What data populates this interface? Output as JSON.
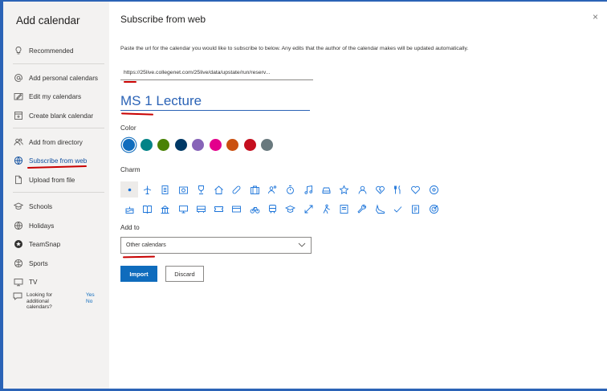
{
  "sidebar": {
    "title": "Add calendar",
    "items": [
      {
        "label": "Recommended",
        "icon": "lightbulb-icon"
      },
      {
        "label": "Add personal calendars",
        "icon": "at-sign-icon"
      },
      {
        "label": "Edit my calendars",
        "icon": "pencil-box-icon"
      },
      {
        "label": "Create blank calendar",
        "icon": "calendar-add-icon"
      },
      {
        "label": "Add from directory",
        "icon": "people-icon"
      },
      {
        "label": "Subscribe from web",
        "icon": "globe-icon"
      },
      {
        "label": "Upload from file",
        "icon": "document-icon"
      },
      {
        "label": "Schools",
        "icon": "graduation-cap-icon"
      },
      {
        "label": "Holidays",
        "icon": "globe-icon"
      },
      {
        "label": "TeamSnap",
        "icon": "teamsnap-icon"
      },
      {
        "label": "Sports",
        "icon": "ball-icon"
      },
      {
        "label": "TV",
        "icon": "tv-icon"
      }
    ],
    "looking_for": {
      "text": "Looking for additional calendars?",
      "yes": "Yes",
      "no": "No"
    },
    "active_color": "#0f4e9e"
  },
  "main": {
    "title": "Subscribe from web",
    "close_label": "×",
    "instructions": "Paste the url for the calendar you would like to subscribe to below. Any edits that the author of the calendar makes will be updated automatically.",
    "url_value": "https://25live.collegenet.com/25live/data/upstate/run/reserv...",
    "name_value": "MS 1 Lecture",
    "color_label": "Color",
    "colors": [
      "#0f6cbd",
      "#038387",
      "#498205",
      "#003966",
      "#8764b8",
      "#e3008c",
      "#ca5010",
      "#c50f1f",
      "#69797e"
    ],
    "charm_label": "Charm",
    "add_to_label": "Add to",
    "add_to_value": "Other calendars",
    "import_label": "Import",
    "discard_label": "Discard",
    "accent": "#0f6cbd"
  }
}
